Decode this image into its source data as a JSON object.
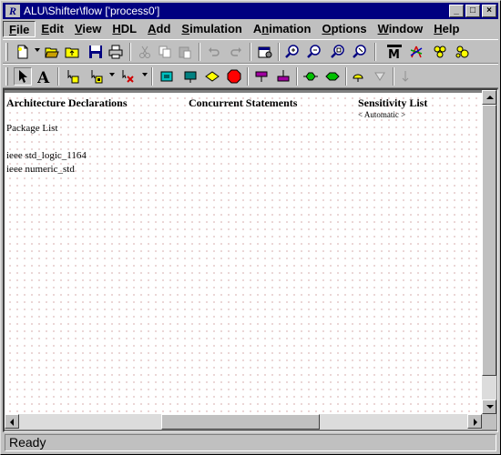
{
  "window": {
    "title": "ALU\\Shifter\\flow ['process0']",
    "app_icon": "R"
  },
  "title_buttons": {
    "minimize": "_",
    "maximize": "□",
    "close": "×"
  },
  "menu": [
    {
      "label": "File",
      "active": true
    },
    {
      "label": "Edit"
    },
    {
      "label": "View"
    },
    {
      "label": "HDL"
    },
    {
      "label": "Add"
    },
    {
      "label": "Simulation"
    },
    {
      "label": "Animation"
    },
    {
      "label": "Options"
    },
    {
      "label": "Window"
    },
    {
      "label": "Help"
    }
  ],
  "toolbar1_icons": [
    "new-document-icon",
    "open-folder-icon",
    "open-parent-icon",
    "save-icon",
    "print-icon",
    "cut-icon",
    "copy-icon",
    "paste-icon",
    "undo-icon",
    "redo-icon",
    "properties-icon",
    "zoom-in-icon",
    "zoom-out-icon",
    "zoom-fit-icon",
    "zoom-selection-icon",
    "modelsim-icon",
    "synthesis-icon",
    "hierarchy-icon",
    "components-icon"
  ],
  "toolbar2_icons": [
    "select-arrow-icon",
    "text-tool-icon",
    "add-block-icon",
    "add-component-icon",
    "delete-connector-icon",
    "state-icon",
    "action-box-icon",
    "decision-icon",
    "stop-point-icon",
    "loop-start-icon",
    "loop-end-icon",
    "wait-icon",
    "start-point-icon",
    "end-point-icon",
    "flow-arrow-icon"
  ],
  "colors": {
    "titlebar": "#000080",
    "canvas_dot": "#d0a0a0",
    "chrome": "#c0c0c0"
  },
  "canvas": {
    "col1_heading": "Architecture Declarations",
    "col2_heading": "Concurrent Statements",
    "col3_heading": "Sensitivity List",
    "sensitivity_value": "< Automatic >",
    "package_heading": "Package List",
    "packages": [
      "ieee std_logic_1164",
      "ieee numeric_std"
    ]
  },
  "status": {
    "text": "Ready"
  }
}
